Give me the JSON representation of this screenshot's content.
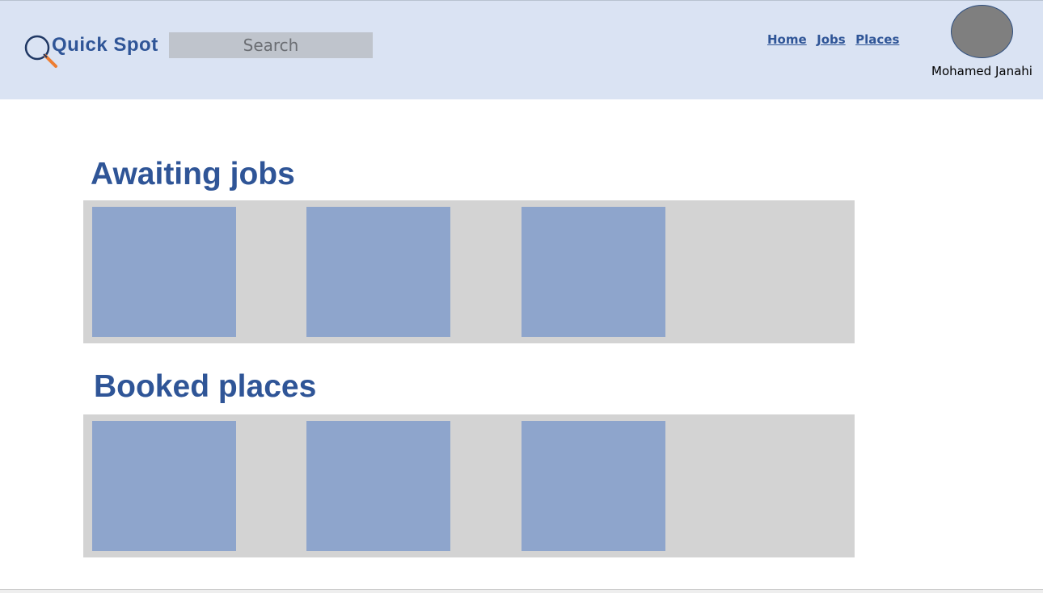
{
  "brand": {
    "name": "Quick Spot",
    "logo_icon": "magnifier-icon"
  },
  "search": {
    "placeholder": "Search"
  },
  "nav": {
    "items": [
      "Home",
      "Jobs",
      "Places"
    ]
  },
  "user": {
    "name": "Mohamed Janahi"
  },
  "sections": [
    {
      "title": "Awaiting jobs",
      "card_count": 3
    },
    {
      "title": "Booked places",
      "card_count": 3
    }
  ],
  "colors": {
    "header_bg": "#dae3f3",
    "accent": "#2f5597",
    "panel_bg": "#d3d3d3",
    "card_bg": "#8ea5cc",
    "avatar": "#7f7f7f"
  }
}
